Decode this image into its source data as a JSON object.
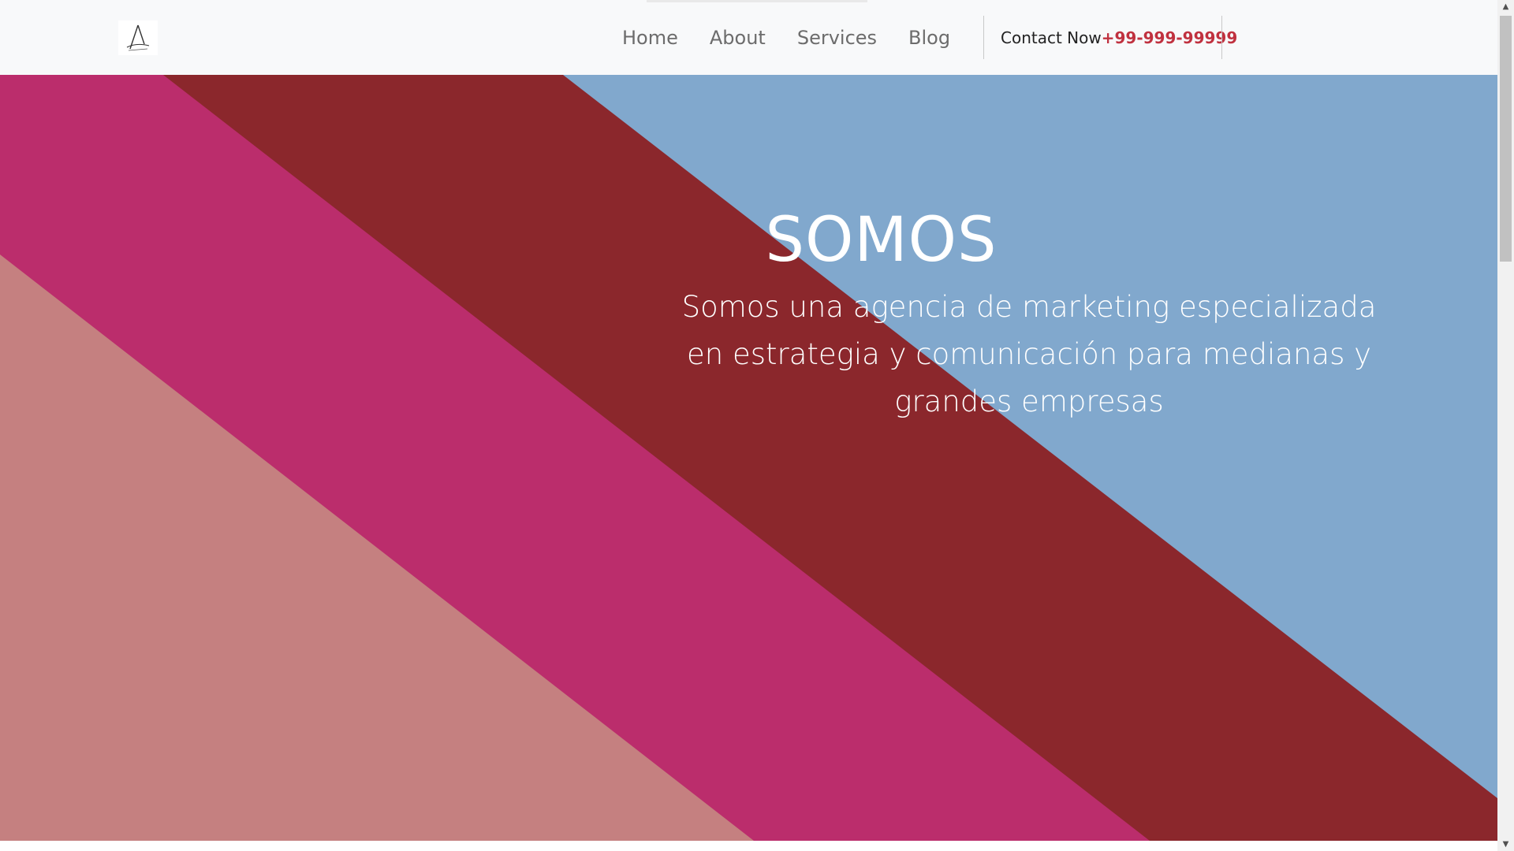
{
  "nav": {
    "logo_name": "logo",
    "links": [
      "Home",
      "About",
      "Services",
      "Blog"
    ],
    "contact_label": "Contact Now",
    "contact_phone": "+99-999-99999"
  },
  "hero": {
    "title": "SOMOS",
    "text": "Somos una agencia de marketing especializada en estrategia y comunicación para medianas y grandes empresas"
  },
  "colors": {
    "navbar_bg": "#f8f9fa",
    "stripe_blue": "#81a8cd",
    "stripe_dark_red": "#8b272c",
    "stripe_magenta": "#bb2d6c",
    "stripe_rose": "#c58080",
    "phone_red": "#c0313f"
  },
  "icons": {
    "scroll_up": "triangle-up-icon",
    "scroll_down": "triangle-down-icon"
  }
}
